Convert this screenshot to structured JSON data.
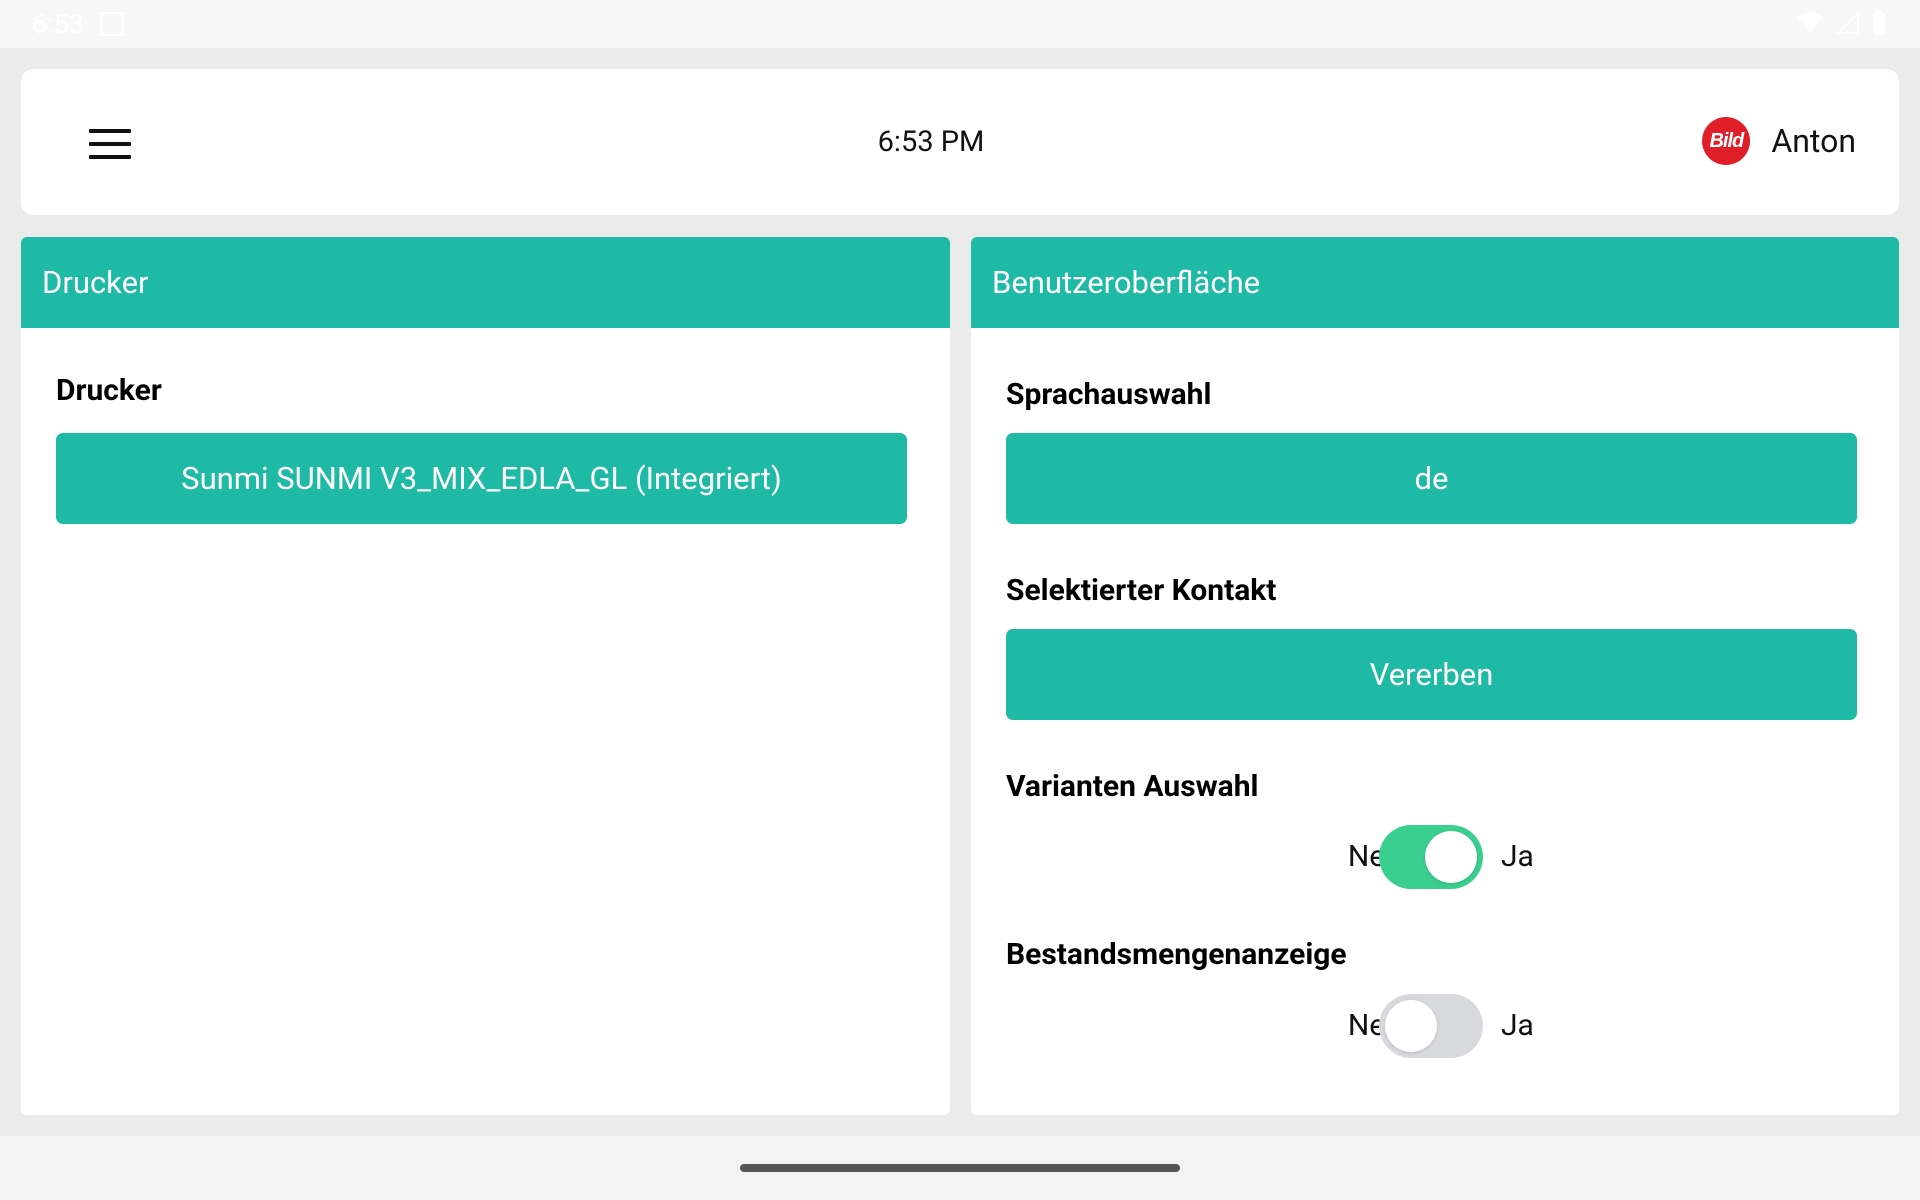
{
  "statusbar": {
    "time": "6:53"
  },
  "header": {
    "time": "6:53 PM",
    "username": "Anton",
    "avatar_logo": "Bild"
  },
  "left_panel": {
    "title": "Drucker",
    "printer_label": "Drucker",
    "printer_value": "Sunmi SUNMI V3_MIX_EDLA_GL (Integriert)"
  },
  "right_panel": {
    "title": "Benutzeroberfläche",
    "language_label": "Sprachauswahl",
    "language_value": "de",
    "contact_label": "Selektierter Kontakt",
    "contact_value": "Vererben",
    "variants_label": "Varianten Auswahl",
    "variants_on": true,
    "stock_label": "Bestandsmengenanzeige",
    "stock_on": false,
    "no_label": "Nein",
    "yes_label": "Ja"
  },
  "colors": {
    "accent": "#1fbaa6",
    "toggle_on": "#3bcf8f",
    "toggle_off": "#d8d9dd",
    "avatar": "#e01e27"
  },
  "icons": [
    "hamburger-menu-icon",
    "window-icon",
    "wifi-icon",
    "signal-icon",
    "battery-icon"
  ]
}
